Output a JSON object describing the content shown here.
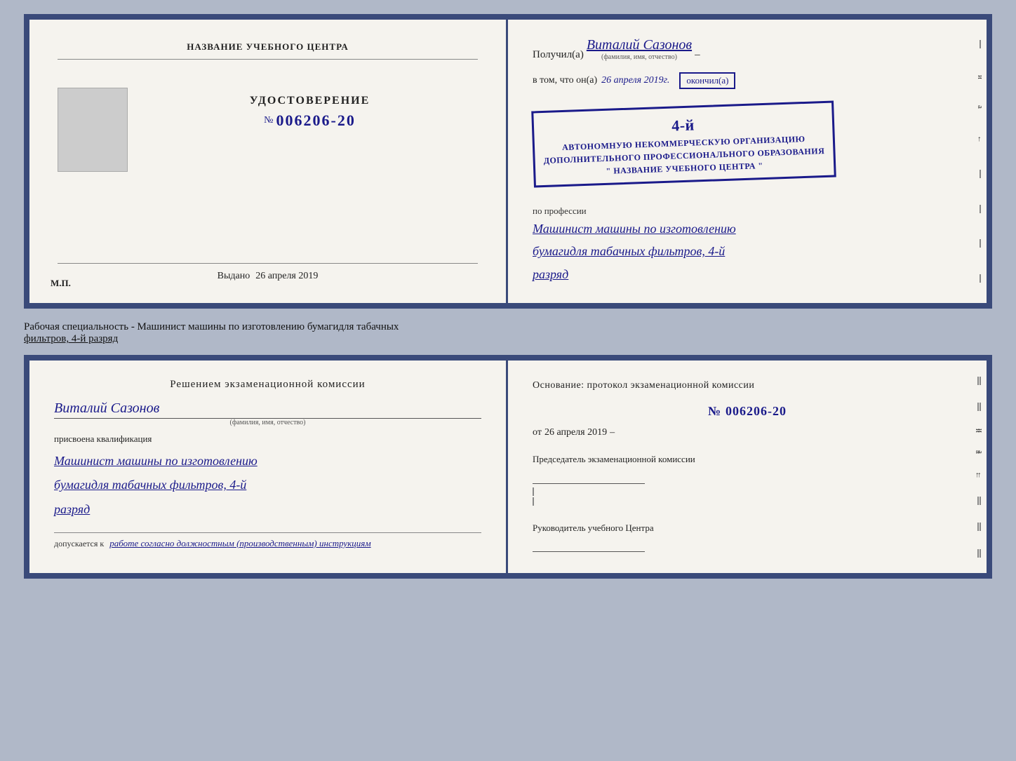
{
  "top_doc": {
    "left": {
      "title_label": "НАЗВАНИЕ УЧЕБНОГО ЦЕНТРА",
      "cert_type_label": "УДОСТОВЕРЕНИЕ",
      "cert_number_prefix": "№",
      "cert_number": "006206-20",
      "issued_label": "Выдано",
      "issued_date": "26 апреля 2019",
      "mp_label": "М.П."
    },
    "right": {
      "received_prefix": "Получил(а)",
      "received_name": "Виталий Сазонов",
      "received_name_hint": "(фамилия, имя, отчество)",
      "vtom_prefix": "в том, что он(а)",
      "vtom_date": "26 апреля 2019г.",
      "okoncil_label": "окончил(а)",
      "stamp_line1": "4-й",
      "stamp_line2": "АВТОНОМНУЮ НЕКОММЕРЧЕСКУЮ ОРГАНИЗАЦИЮ",
      "stamp_line3": "ДОПОЛНИТЕЛЬНОГО ПРОФЕССИОНАЛЬНОГО ОБРАЗОВАНИЯ",
      "stamp_line4": "\" НАЗВАНИЕ УЧЕБНОГО ЦЕНТРА \"",
      "profession_prefix": "по профессии",
      "profession_line1": "Машинист машины по изготовлению",
      "profession_line2": "бумагидля табачных фильтров, 4-й",
      "profession_line3": "разряд"
    }
  },
  "specialty_text": {
    "line1": "Рабочая специальность - Машинист машины по изготовлению бумагидля табачных",
    "line2": "фильтров, 4-й разряд"
  },
  "bottom_doc": {
    "left": {
      "decision_title": "Решением экзаменационной комиссии",
      "name": "Виталий Сазонов",
      "name_hint": "(фамилия, имя, отчество)",
      "assigned_label": "присвоена квалификация",
      "qualification_line1": "Машинист машины по изготовлению",
      "qualification_line2": "бумагидля табачных фильтров, 4-й",
      "qualification_line3": "разряд",
      "allowed_prefix": "допускается к",
      "allowed_text": "работе согласно должностным (производственным) инструкциям"
    },
    "right": {
      "basis_label": "Основание: протокол экзаменационной комиссии",
      "protocol_prefix": "№",
      "protocol_number": "006206-20",
      "date_prefix": "от",
      "date_value": "26 апреля 2019",
      "chairman_label": "Председатель экзаменационной комиссии",
      "director_label": "Руководитель учебного Центра"
    }
  }
}
